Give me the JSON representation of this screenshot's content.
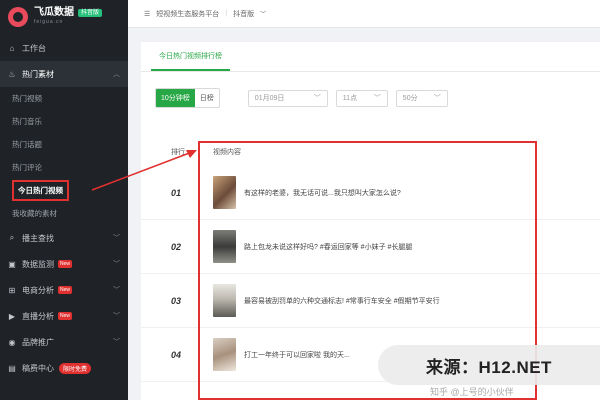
{
  "app": {
    "name": "飞瓜数据",
    "badge": "抖音版",
    "sub": "feigua.cn"
  },
  "topbar": {
    "menu_icon": "list-icon",
    "title": "短视频生态服务平台",
    "sep": "|",
    "platform": "抖音版"
  },
  "sidebar": {
    "items": [
      {
        "label": "工作台",
        "icon": "home-icon"
      },
      {
        "label": "热门素材",
        "icon": "fire-icon",
        "open": true
      },
      {
        "label": "播主查找",
        "icon": "search-icon"
      },
      {
        "label": "数据监测",
        "icon": "monitor-icon",
        "badge": "New"
      },
      {
        "label": "电商分析",
        "icon": "cart-icon",
        "badge": "New"
      },
      {
        "label": "直播分析",
        "icon": "live-icon",
        "badge": "New"
      },
      {
        "label": "品牌推广",
        "icon": "brand-icon"
      },
      {
        "label": "稿费中心",
        "icon": "wallet-icon",
        "badge": "限时免费"
      }
    ],
    "sub_items": [
      {
        "label": "热门视频"
      },
      {
        "label": "热门音乐"
      },
      {
        "label": "热门话题"
      },
      {
        "label": "热门评论"
      },
      {
        "label": "今日热门视频",
        "active": true
      },
      {
        "label": "我收藏的素材"
      }
    ]
  },
  "main": {
    "tab": "今日热门视频排行榜",
    "segments": [
      "10分钟榜",
      "日榜"
    ],
    "date_select": "01月09日",
    "hour_select": "11点",
    "minute_select": "50分",
    "columns": {
      "rank": "排行",
      "content": "视频内容"
    },
    "rows": [
      {
        "rank": "01",
        "title": "有这样的老婆，我无话可说...我只想叫大家怎么说?"
      },
      {
        "rank": "02",
        "title": "路上包龙未说这样好吗? #春运回家等 #小妹子 #长腿腿"
      },
      {
        "rank": "03",
        "title": "最容易被刮罚单的六种交通标志! #常事行车安全 #假期节平安行"
      },
      {
        "rank": "04",
        "title": "打工一年终于可以回家啦 我的天..."
      }
    ]
  },
  "watermark": {
    "text": "来源：H12.NET",
    "sub": "知乎 @上号的小伙伴"
  },
  "colors": {
    "accent": "#27a745",
    "highlight": "#e0302f",
    "sidebar_bg": "#1f2327"
  }
}
